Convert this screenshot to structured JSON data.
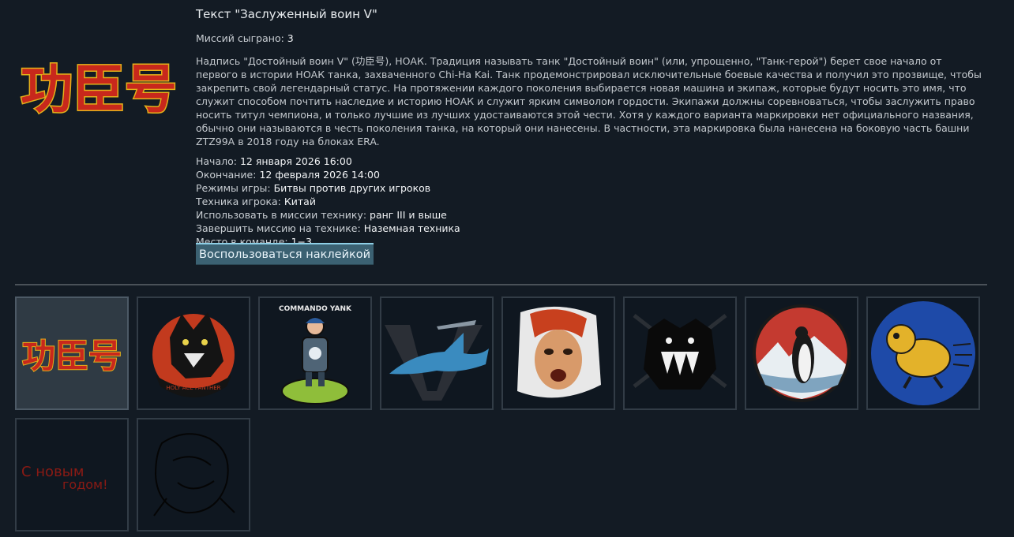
{
  "decal": {
    "preview_glyphs": "功臣号",
    "title": "Текст \"Заслуженный воин V\"",
    "missions_label": "Миссий сыграно:",
    "missions_value": "3",
    "description": "Надпись \"Достойный воин V\" (功臣号), НОАК. Традиция называть танк \"Достойный воин\" (или, упрощенно, \"Танк-герой\") берет свое начало от первого в истории НОАК танка, захваченного Chi-Ha Kai. Танк продемонстрировал исключительные боевые качества и получил это прозвище, чтобы закрепить свой легендарный статус. На протяжении каждого поколения выбирается новая машина и экипаж, которые будут носить это имя, что служит способом почтить наследие и историю НОАК и служит ярким символом гордости. Экипажи должны соревноваться, чтобы заслужить право носить титул чемпиона, и только лучшие из лучших удостаиваются этой чести. Хотя у каждого варианта маркировки нет официального названия, обычно они называются в честь поколения танка, на который они нанесены. В частности, эта маркировка была нанесена на боковую часть башни ZTZ99A в 2018 году на блоках ERA.",
    "details": [
      {
        "label": "Начало:",
        "value": "12 января 2026 16:00"
      },
      {
        "label": "Окончание:",
        "value": "12 февраля 2026 14:00"
      },
      {
        "label": "Режимы игры:",
        "value": "Битвы против других игроков"
      },
      {
        "label": "Техника игрока:",
        "value": "Китай"
      },
      {
        "label": "Использовать в миссии технику:",
        "value": "ранг III и выше"
      },
      {
        "label": "Завершить миссию на технике:",
        "value": "Наземная техника"
      },
      {
        "label": "Место в команде:",
        "value": "1−3"
      }
    ],
    "use_button": "Воспользоваться наклейкой"
  },
  "gallery": {
    "tiles": [
      {
        "id": "hanzi-text",
        "icon": "hanzi-decal-icon",
        "selected": true
      },
      {
        "id": "panther",
        "icon": "panther-squadron-icon",
        "badge_text": "HOLY ACE PANTHER",
        "selected": false
      },
      {
        "id": "commando",
        "icon": "commando-yank-icon",
        "badge_text": "COMMANDO YANK",
        "selected": false
      },
      {
        "id": "shark",
        "icon": "v-shark-icon",
        "selected": false
      },
      {
        "id": "redhead",
        "icon": "screaming-face-icon",
        "selected": false
      },
      {
        "id": "beast",
        "icon": "beast-crossed-swords-icon",
        "selected": false
      },
      {
        "id": "penguin",
        "icon": "penguin-icon",
        "selected": false
      },
      {
        "id": "dog",
        "icon": "running-dog-icon",
        "selected": false
      },
      {
        "id": "newyear",
        "icon": "new-year-text-icon",
        "text_line1": "С новым",
        "text_line2": "годом!",
        "selected": false
      },
      {
        "id": "sketch",
        "icon": "dark-sketch-icon",
        "selected": false
      }
    ]
  },
  "colors": {
    "background": "#131b24",
    "decal_red": "#c8281c",
    "decal_gold": "#e3b21a",
    "button_bg": "#3b6172",
    "button_border": "#8ecfe6"
  }
}
